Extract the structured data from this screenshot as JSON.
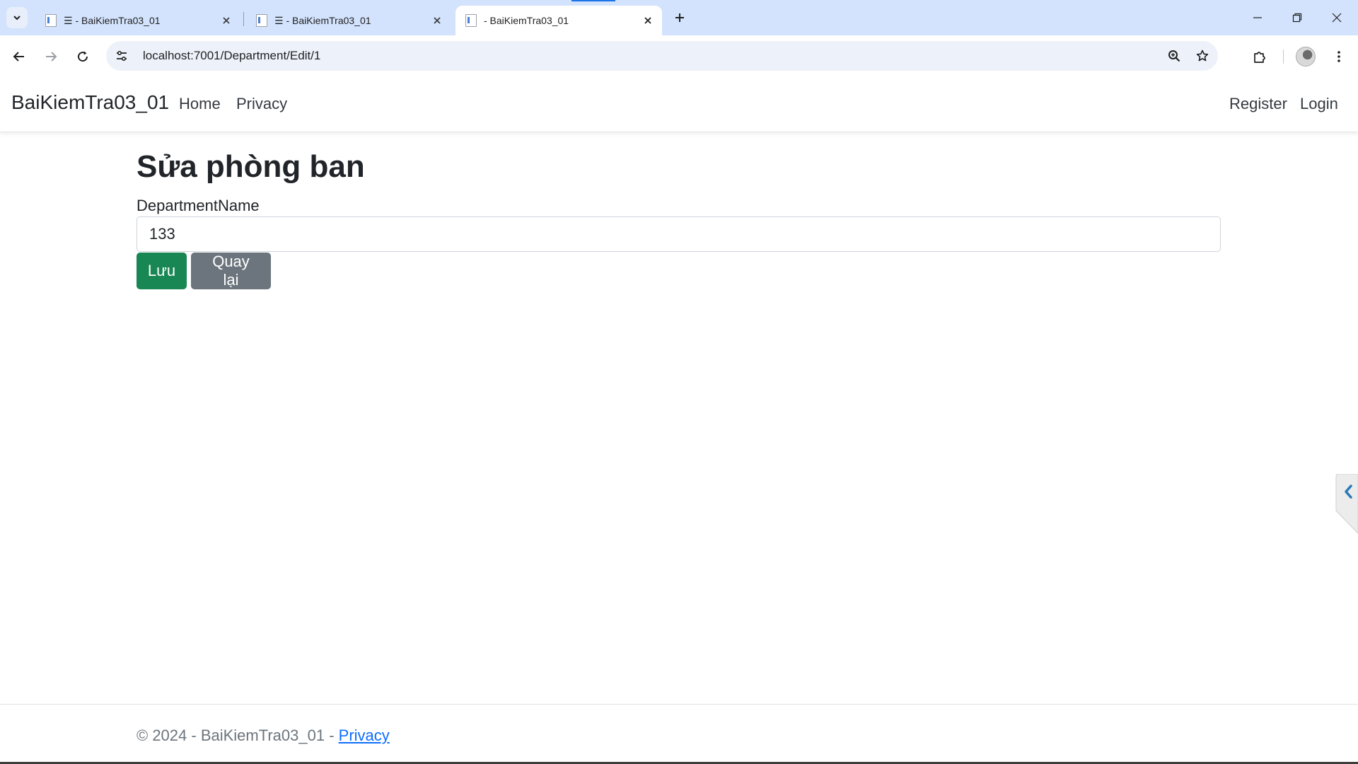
{
  "browser": {
    "tabs": [
      {
        "title": "☰ - BaiKiemTra03_01",
        "active": false
      },
      {
        "title": "☰ - BaiKiemTra03_01",
        "active": false
      },
      {
        "title": "- BaiKiemTra03_01",
        "active": true
      }
    ],
    "url": "localhost:7001/Department/Edit/1"
  },
  "navbar": {
    "brand": "BaiKiemTra03_01",
    "links": [
      "Home",
      "Privacy"
    ],
    "right_links": [
      "Register",
      "Login"
    ]
  },
  "main": {
    "title": "Sửa phòng ban",
    "field_label": "DepartmentName",
    "field_value": "133",
    "save_label": "Lưu",
    "back_label": "Quay lại"
  },
  "footer": {
    "text": "© 2024 - BaiKiemTra03_01 - ",
    "link": "Privacy"
  },
  "colors": {
    "success": "#198754",
    "secondary": "#6c757d",
    "link": "#0d6efd",
    "tabstrip": "#d3e3fd"
  }
}
